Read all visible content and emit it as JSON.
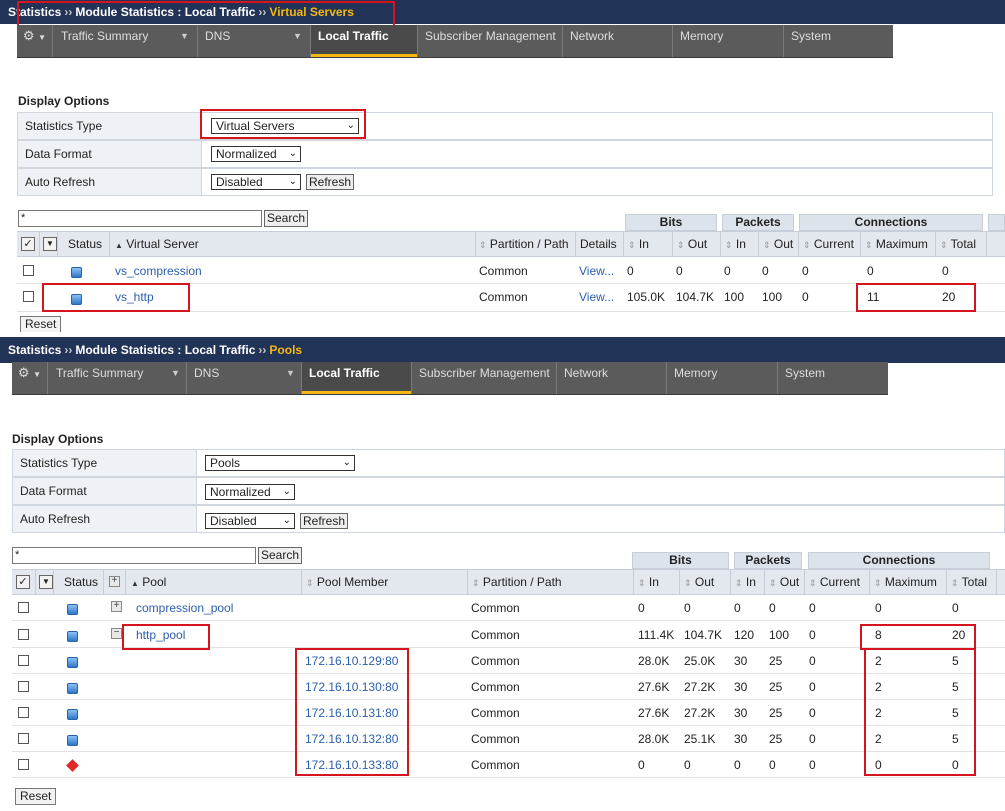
{
  "top": {
    "breadcrumb": {
      "part1": "Statistics",
      "sep": "››",
      "part2": "Module Statistics : Local Traffic",
      "current": "Virtual Servers"
    },
    "nav": {
      "tabs": [
        "Traffic Summary",
        "DNS",
        "Local Traffic",
        "Subscriber Management",
        "Network",
        "Memory",
        "System"
      ],
      "active": "Local Traffic"
    },
    "display_options": {
      "title": "Display Options",
      "statistics_type_label": "Statistics Type",
      "statistics_type_value": "Virtual Servers",
      "data_format_label": "Data Format",
      "data_format_value": "Normalized",
      "auto_refresh_label": "Auto Refresh",
      "auto_refresh_value": "Disabled",
      "refresh_button": "Refresh"
    },
    "search_value": "*",
    "search_button": "Search",
    "groups": {
      "bits": "Bits",
      "packets": "Packets",
      "connections": "Connections"
    },
    "columns": {
      "status": "Status",
      "virtual_server": "Virtual Server",
      "partition": "Partition / Path",
      "details": "Details",
      "in": "In",
      "out": "Out",
      "current": "Current",
      "maximum": "Maximum",
      "total": "Total"
    },
    "rows": [
      {
        "name": "vs_compression",
        "partition": "Common",
        "details": "View...",
        "bits_in": "0",
        "bits_out": "0",
        "pkt_in": "0",
        "pkt_out": "0",
        "current": "0",
        "maximum": "0",
        "total": "0"
      },
      {
        "name": "vs_http",
        "partition": "Common",
        "details": "View...",
        "bits_in": "105.0K",
        "bits_out": "104.7K",
        "pkt_in": "100",
        "pkt_out": "100",
        "current": "0",
        "maximum": "11",
        "total": "20"
      }
    ],
    "reset_button": "Reset"
  },
  "bottom": {
    "breadcrumb": {
      "part1": "Statistics",
      "sep": "››",
      "part2": "Module Statistics : Local Traffic",
      "current": "Pools"
    },
    "nav": {
      "tabs": [
        "Traffic Summary",
        "DNS",
        "Local Traffic",
        "Subscriber Management",
        "Network",
        "Memory",
        "System"
      ],
      "active": "Local Traffic"
    },
    "display_options": {
      "title": "Display Options",
      "statistics_type_label": "Statistics Type",
      "statistics_type_value": "Pools",
      "data_format_label": "Data Format",
      "data_format_value": "Normalized",
      "auto_refresh_label": "Auto Refresh",
      "auto_refresh_value": "Disabled",
      "refresh_button": "Refresh"
    },
    "search_value": "*",
    "search_button": "Search",
    "groups": {
      "bits": "Bits",
      "packets": "Packets",
      "connections": "Connections"
    },
    "columns": {
      "status": "Status",
      "pool": "Pool",
      "pool_member": "Pool Member",
      "partition": "Partition / Path",
      "in": "In",
      "out": "Out",
      "current": "Current",
      "maximum": "Maximum",
      "total": "Total"
    },
    "rows": [
      {
        "pool": "compression_pool",
        "member": "",
        "partition": "Common",
        "bits_in": "0",
        "bits_out": "0",
        "pkt_in": "0",
        "pkt_out": "0",
        "current": "0",
        "maximum": "0",
        "total": "0",
        "status": "blue"
      },
      {
        "pool": "http_pool",
        "member": "",
        "partition": "Common",
        "bits_in": "111.4K",
        "bits_out": "104.7K",
        "pkt_in": "120",
        "pkt_out": "100",
        "current": "0",
        "maximum": "8",
        "total": "20",
        "status": "blue"
      },
      {
        "pool": "",
        "member": "172.16.10.129:80",
        "partition": "Common",
        "bits_in": "28.0K",
        "bits_out": "25.0K",
        "pkt_in": "30",
        "pkt_out": "25",
        "current": "0",
        "maximum": "2",
        "total": "5",
        "status": "blue"
      },
      {
        "pool": "",
        "member": "172.16.10.130:80",
        "partition": "Common",
        "bits_in": "27.6K",
        "bits_out": "27.2K",
        "pkt_in": "30",
        "pkt_out": "25",
        "current": "0",
        "maximum": "2",
        "total": "5",
        "status": "blue"
      },
      {
        "pool": "",
        "member": "172.16.10.131:80",
        "partition": "Common",
        "bits_in": "27.6K",
        "bits_out": "27.2K",
        "pkt_in": "30",
        "pkt_out": "25",
        "current": "0",
        "maximum": "2",
        "total": "5",
        "status": "blue"
      },
      {
        "pool": "",
        "member": "172.16.10.132:80",
        "partition": "Common",
        "bits_in": "28.0K",
        "bits_out": "25.1K",
        "pkt_in": "30",
        "pkt_out": "25",
        "current": "0",
        "maximum": "2",
        "total": "5",
        "status": "blue"
      },
      {
        "pool": "",
        "member": "172.16.10.133:80",
        "partition": "Common",
        "bits_in": "0",
        "bits_out": "0",
        "pkt_in": "0",
        "pkt_out": "0",
        "current": "0",
        "maximum": "0",
        "total": "0",
        "status": "red"
      }
    ],
    "reset_button": "Reset"
  },
  "colors": {
    "breadcrumb_bg": "#223358",
    "active_accent": "#f3b716",
    "nav_bg": "#5b5b5b",
    "highlight_border": "#d6141e",
    "link": "#2b5fad",
    "status_available": "#2e76c9",
    "status_offline": "#e02828"
  },
  "icons": [
    "gear-icon",
    "checkbox-icon",
    "chevron-down-icon",
    "sort-icon",
    "expand-icon",
    "collapse-icon",
    "status-available-icon",
    "status-offline-icon"
  ]
}
